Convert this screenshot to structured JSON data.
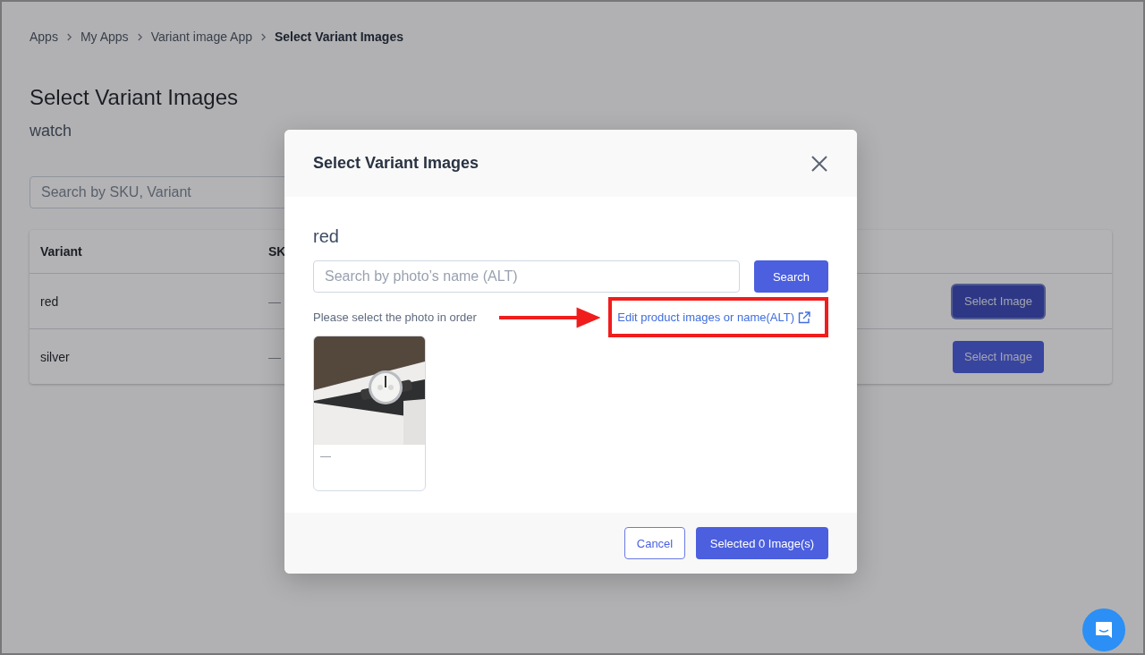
{
  "breadcrumb": [
    {
      "label": "Apps",
      "current": false
    },
    {
      "label": "My Apps",
      "current": false
    },
    {
      "label": "Variant image App",
      "current": false
    },
    {
      "label": "Select Variant Images",
      "current": true
    }
  ],
  "page": {
    "title": "Select Variant Images",
    "subtitle": "watch",
    "search": {
      "placeholder": "Search by SKU, Variant"
    }
  },
  "table": {
    "columns": [
      "Variant",
      "SK"
    ],
    "rows": [
      {
        "variant": "red",
        "sku": "—",
        "action": "Select Image",
        "focused": true
      },
      {
        "variant": "silver",
        "sku": "—",
        "action": "Select Image",
        "focused": false
      }
    ]
  },
  "modal": {
    "title": "Select Variant Images",
    "variant": "red",
    "search": {
      "placeholder": "Search by photo’s name (ALT)"
    },
    "search_button": "Search",
    "hint": "Please select the photo in order",
    "edit_link": "Edit product images or name(ALT)",
    "photos": [
      {
        "kind": "picture",
        "caption": "—",
        "selected": false
      }
    ],
    "buttons": [
      {
        "kind": "secondary",
        "label": "Cancel"
      },
      {
        "kind": "primary",
        "label": "Selected 0 Image(s)"
      }
    ]
  }
}
